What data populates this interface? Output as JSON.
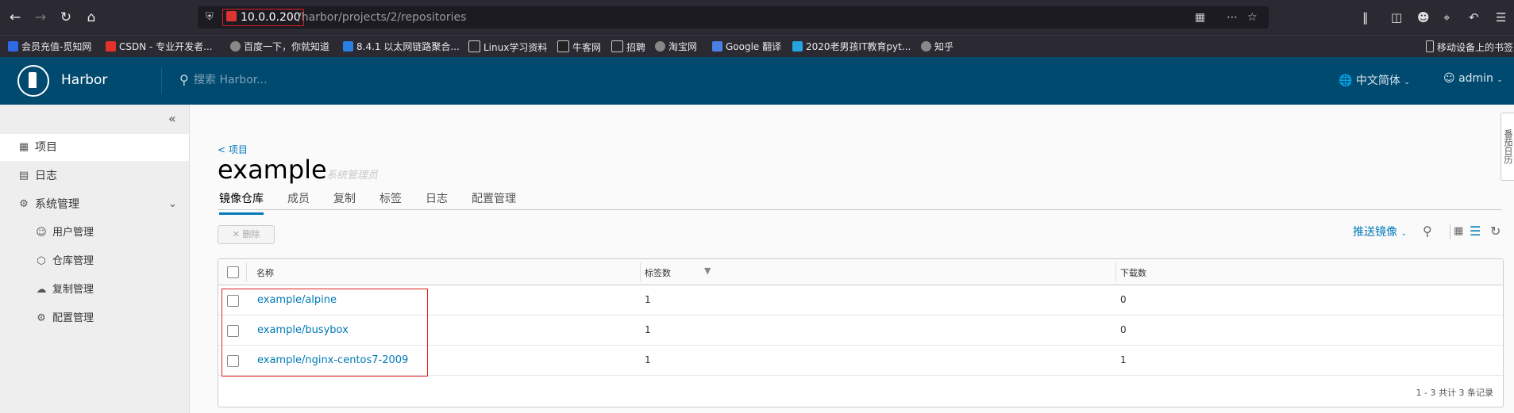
{
  "browser": {
    "url_host": "10.0.0.200",
    "url_path": "/harbor/projects/2/repositories",
    "bookmarks": [
      "会员充值-觅知网",
      "CSDN - 专业开发者...",
      "百度一下，你就知道",
      "8.4.1 以太网链路聚合...",
      "Linux学习资料",
      "牛客网",
      "招聘",
      "淘宝网",
      "Google 翻译",
      "2020老男孩IT教育pyt...",
      "知乎",
      "移动设备上的书签"
    ]
  },
  "header": {
    "brand": "Harbor",
    "search_placeholder": "搜索 Harbor...",
    "language": "中文简体",
    "user": "admin"
  },
  "sidebar": {
    "items": [
      {
        "label": "项目",
        "icon": "projects-icon"
      },
      {
        "label": "日志",
        "icon": "logs-icon"
      },
      {
        "label": "系统管理",
        "icon": "admin-icon"
      },
      {
        "label": "用户管理",
        "icon": "users-icon"
      },
      {
        "label": "仓库管理",
        "icon": "registry-icon"
      },
      {
        "label": "复制管理",
        "icon": "replication-icon"
      },
      {
        "label": "配置管理",
        "icon": "config-icon"
      }
    ]
  },
  "main": {
    "back_label": "< 项目",
    "project_name": "example",
    "role": "系统管理员",
    "tabs": [
      "镜像仓库",
      "成员",
      "复制",
      "标签",
      "日志",
      "配置管理"
    ],
    "delete_label": "删除",
    "push_label": "推送镜像"
  },
  "grid": {
    "columns": [
      "名称",
      "标签数",
      "下载数"
    ],
    "rows": [
      {
        "name": "example/alpine",
        "tags": "1",
        "pulls": "0"
      },
      {
        "name": "example/busybox",
        "tags": "1",
        "pulls": "0"
      },
      {
        "name": "example/nginx-centos7-2009",
        "tags": "1",
        "pulls": "1"
      }
    ],
    "footer": "1 - 3 共计 3 条记录"
  },
  "right_tab": "番茄日历",
  "colors": {
    "header": "#004a70",
    "link": "#0079b8",
    "highlight": "#e02020"
  }
}
